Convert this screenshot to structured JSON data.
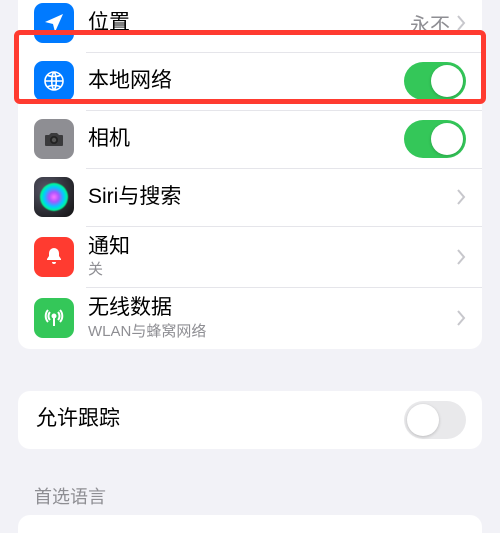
{
  "rows": {
    "location": {
      "label": "位置",
      "value": "永不"
    },
    "localNetwork": {
      "label": "本地网络",
      "enabled": true
    },
    "camera": {
      "label": "相机",
      "enabled": true
    },
    "siri": {
      "label": "Siri与搜索"
    },
    "notifications": {
      "label": "通知",
      "sublabel": "关"
    },
    "wirelessData": {
      "label": "无线数据",
      "sublabel": "WLAN与蜂窝网络"
    },
    "allowTracking": {
      "label": "允许跟踪",
      "enabled": false
    }
  },
  "headers": {
    "preferredLanguage": "首选语言"
  }
}
